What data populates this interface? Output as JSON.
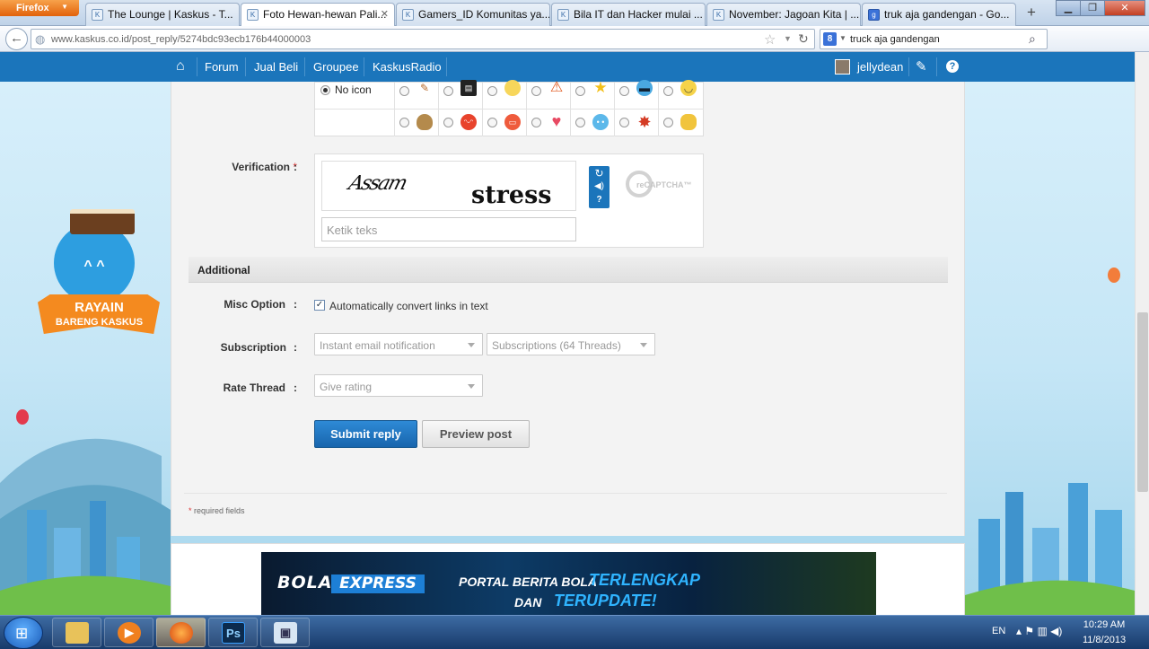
{
  "browser": {
    "menu_label": "Firefox",
    "tabs": [
      {
        "title": "The Lounge | Kaskus - T..."
      },
      {
        "title": "Foto Hewan-hewan Pali..."
      },
      {
        "title": "Gamers_ID Komunitas ya..."
      },
      {
        "title": "Bila IT dan Hacker mulai ..."
      },
      {
        "title": "November: Jagoan Kita | ..."
      },
      {
        "title": "truk aja gandengan - Go..."
      }
    ],
    "url": "www.kaskus.co.id/post_reply/5274bdc93ecb176b44000003",
    "search_value": "truck aja gandengan",
    "search_engine_letter": "8"
  },
  "site_nav": {
    "items": [
      "Forum",
      "Jual Beli",
      "Groupee",
      "KaskusRadio"
    ],
    "username": "jellydean"
  },
  "post_icons": {
    "no_icon_label": "No icon",
    "row1": [
      "pencil-icon",
      "clapper-icon",
      "bulb-icon",
      "warning-icon",
      "star-icon",
      "cool-icon",
      "smile-icon"
    ],
    "row2": [
      "poop-icon",
      "angry-icon",
      "laugh-icon",
      "heart-icon",
      "sad-icon",
      "burst-icon",
      "thumb-icon"
    ]
  },
  "verification": {
    "label": "Verification",
    "required_mark": "*",
    "captcha_word1": "Assam",
    "captcha_word2": "stress",
    "input_placeholder": "Ketik teks",
    "recaptcha_logo": "reCAPTCHA™"
  },
  "additional": {
    "header": "Additional",
    "misc_label": "Misc Option",
    "misc_checkbox_label": "Automatically convert links in text",
    "misc_checked": true,
    "subscription_label": "Subscription",
    "subscription_select1": "Instant email notification",
    "subscription_select2": "Subscriptions (64 Threads)",
    "rate_label": "Rate Thread",
    "rate_select": "Give rating",
    "colon": ":"
  },
  "actions": {
    "submit": "Submit reply",
    "preview": "Preview post"
  },
  "footer_note": {
    "mark": "*",
    "text": " required fields"
  },
  "promo": {
    "line1": "RAYAIN",
    "line2": "BARENG KASKUS"
  },
  "banner": {
    "bola": "BOLA",
    "express": "EXPRESS",
    "text1": "PORTAL BERITA BOLA",
    "text2": "TERLENGKAP",
    "text3": "DAN",
    "text4": "TERUPDATE!"
  },
  "taskbar": {
    "lang": "EN",
    "time": "10:29 AM",
    "date": "11/8/2013",
    "apps": [
      "explorer",
      "media-player",
      "firefox",
      "photoshop",
      "remote-desktop"
    ],
    "ps_label": "Ps"
  }
}
